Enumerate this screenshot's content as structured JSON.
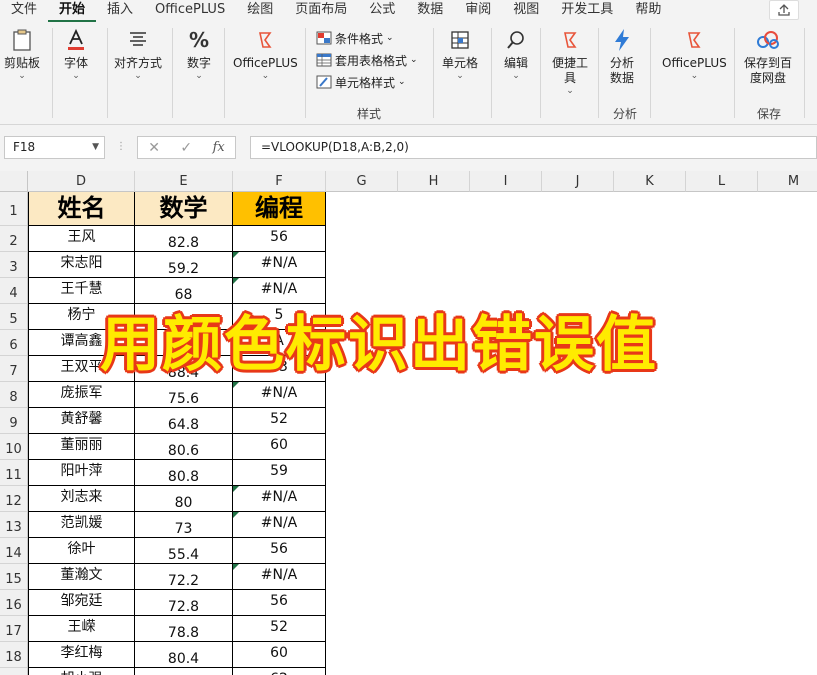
{
  "ribbon": {
    "tabs": [
      "文件",
      "开始",
      "插入",
      "OfficePLUS",
      "绘图",
      "页面布局",
      "公式",
      "数据",
      "审阅",
      "视图",
      "开发工具",
      "帮助"
    ],
    "active_tab": "开始",
    "groups": {
      "clipboard": "剪贴板",
      "font": "字体",
      "align": "对齐方式",
      "number": "数字",
      "officeplus": "OfficePLUS",
      "cond_format": "条件格式",
      "table_format": "套用表格格式",
      "cell_style": "单元格样式",
      "styles_label": "样式",
      "cells": "单元格",
      "edit": "编辑",
      "quick_tools": "便捷工具",
      "analyze": "分析数据",
      "analyze_label": "分析",
      "officeplus2": "OfficePLUS",
      "save_netdisk": "保存到百度网盘",
      "save_label": "保存"
    }
  },
  "formula_bar": {
    "name_box": "F18",
    "formula": "=VLOOKUP(D18,A:B,2,0)",
    "fx": "fx"
  },
  "columns": [
    "D",
    "E",
    "F",
    "G",
    "H",
    "I",
    "J",
    "K",
    "L",
    "M"
  ],
  "row_numbers": [
    "1",
    "2",
    "3",
    "4",
    "5",
    "6",
    "7",
    "8",
    "9",
    "10",
    "11",
    "12",
    "13",
    "14",
    "15",
    "16",
    "17",
    "18",
    "19"
  ],
  "headers": [
    "姓名",
    "数学",
    "编程"
  ],
  "rows": [
    {
      "name": "王风",
      "math": "82.8",
      "prog": "56",
      "err": false
    },
    {
      "name": "宋志阳",
      "math": "59.2",
      "prog": "#N/A",
      "err": true
    },
    {
      "name": "王千慧",
      "math": "68",
      "prog": "#N/A",
      "err": true
    },
    {
      "name": "杨宁",
      "math": "",
      "prog": "5",
      "err": false
    },
    {
      "name": "谭高鑫",
      "math": "",
      "prog": "A",
      "err": true
    },
    {
      "name": "王双平",
      "math": "88.4",
      "prog": "63",
      "err": false
    },
    {
      "name": "庞振军",
      "math": "75.6",
      "prog": "#N/A",
      "err": true
    },
    {
      "name": "黄舒馨",
      "math": "64.8",
      "prog": "52",
      "err": false
    },
    {
      "name": "董丽丽",
      "math": "80.6",
      "prog": "60",
      "err": false
    },
    {
      "name": "阳叶萍",
      "math": "80.8",
      "prog": "59",
      "err": false
    },
    {
      "name": "刘志来",
      "math": "80",
      "prog": "#N/A",
      "err": true
    },
    {
      "name": "范凯媛",
      "math": "73",
      "prog": "#N/A",
      "err": true
    },
    {
      "name": "徐叶",
      "math": "55.4",
      "prog": "56",
      "err": false
    },
    {
      "name": "董瀚文",
      "math": "72.2",
      "prog": "#N/A",
      "err": true
    },
    {
      "name": "邹宛廷",
      "math": "72.8",
      "prog": "56",
      "err": false
    },
    {
      "name": "王嵘",
      "math": "78.8",
      "prog": "52",
      "err": false
    },
    {
      "name": "李红梅",
      "math": "80.4",
      "prog": "60",
      "err": false
    },
    {
      "name": "胡小强",
      "math": "79.4",
      "prog": "62",
      "err": false
    }
  ],
  "banner": "用颜色标识出错误值",
  "colors": {
    "header_name_bg": "#fce9c3",
    "header_math_bg": "#fce9c3",
    "header_prog_bg": "#ffc000",
    "error_marker": "#217346",
    "banner_fill": "#ffeb00",
    "banner_outline": "#e83818"
  }
}
